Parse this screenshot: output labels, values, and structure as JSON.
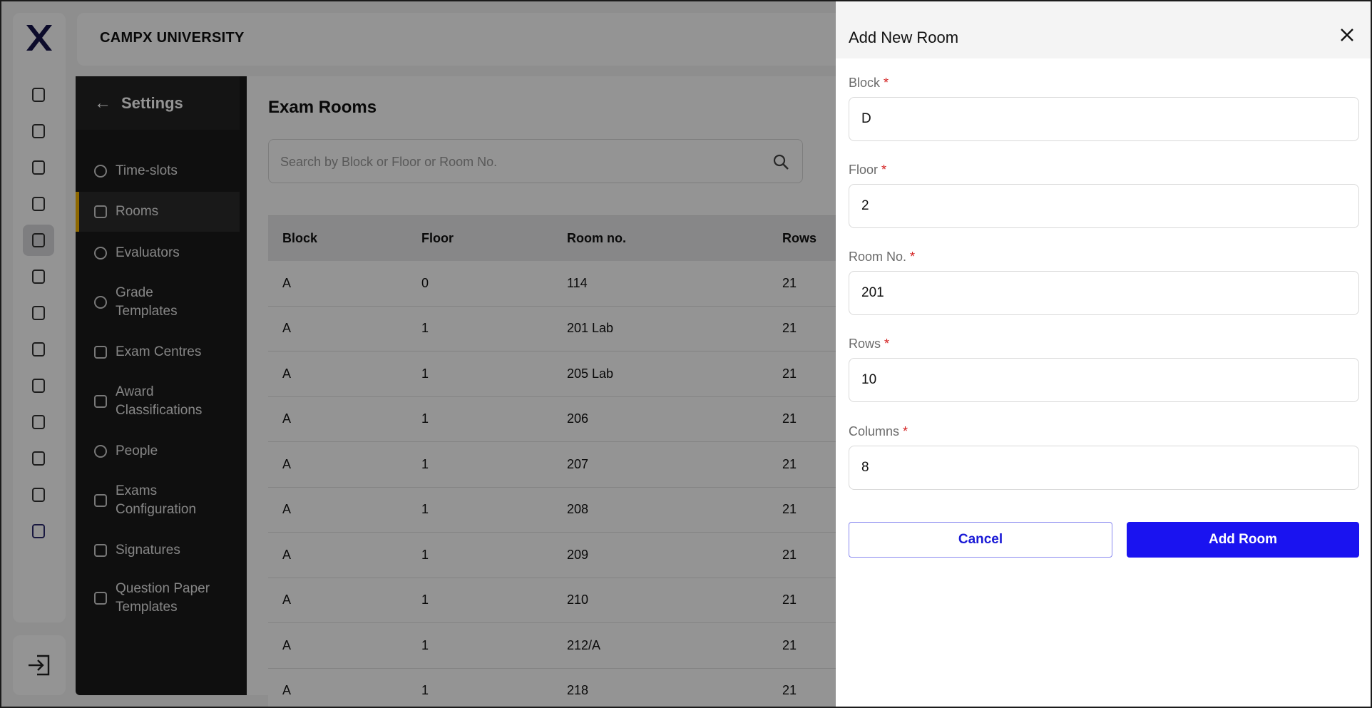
{
  "app": {
    "name": "CAMPX UNIVERSITY",
    "logo_glyph": "X"
  },
  "rail": {
    "icons": [
      "clipboard-icon",
      "book-icon",
      "users-icon",
      "bolt-icon",
      "hourglass-icon",
      "shield-user-icon",
      "user-add-icon",
      "bus-icon",
      "spreadsheet-icon",
      "location-shield-icon",
      "chart-icon",
      "calendar-icon",
      "settings-hex-icon"
    ],
    "active_index": 4,
    "logout_icon": "logout-icon"
  },
  "settings": {
    "back_label": "Settings",
    "items": [
      {
        "label": "Time-slots",
        "icon": "timer-icon"
      },
      {
        "label": "Rooms",
        "icon": "building-icon",
        "active": true
      },
      {
        "label": "Evaluators",
        "icon": "user-search-icon"
      },
      {
        "label": "Grade Templates",
        "icon": "palette-icon"
      },
      {
        "label": "Exam Centres",
        "icon": "building-icon"
      },
      {
        "label": "Award Classifications",
        "icon": "graduation-cap-icon"
      },
      {
        "label": "People",
        "icon": "people-icon"
      },
      {
        "label": "Exams Configuration",
        "icon": "clipboard-check-icon"
      },
      {
        "label": "Signatures",
        "icon": "signature-icon"
      },
      {
        "label": "Question Paper Templates",
        "icon": "document-edit-icon"
      }
    ]
  },
  "main": {
    "title": "Exam Rooms",
    "search_placeholder": "Search by Block or Floor or Room No.",
    "table": {
      "headers": [
        "Block",
        "Floor",
        "Room no.",
        "Rows"
      ],
      "rows": [
        [
          "A",
          "0",
          "114",
          "21"
        ],
        [
          "A",
          "1",
          "201 Lab",
          "21"
        ],
        [
          "A",
          "1",
          "205 Lab",
          "21"
        ],
        [
          "A",
          "1",
          "206",
          "21"
        ],
        [
          "A",
          "1",
          "207",
          "21"
        ],
        [
          "A",
          "1",
          "208",
          "21"
        ],
        [
          "A",
          "1",
          "209",
          "21"
        ],
        [
          "A",
          "1",
          "210",
          "21"
        ],
        [
          "A",
          "1",
          "212/A",
          "21"
        ],
        [
          "A",
          "1",
          "218",
          "21"
        ]
      ]
    }
  },
  "drawer": {
    "title": "Add New Room",
    "fields": [
      {
        "label": "Block",
        "value": "D"
      },
      {
        "label": "Floor",
        "value": "2"
      },
      {
        "label": "Room No.",
        "value": "201"
      },
      {
        "label": "Rows",
        "value": "10"
      },
      {
        "label": "Columns",
        "value": "8"
      }
    ],
    "required_mark": "*",
    "cancel_label": "Cancel",
    "submit_label": "Add Room"
  },
  "colors": {
    "accent": "#1a13f0",
    "active_marker": "#f5b400",
    "required": "#d32020"
  }
}
